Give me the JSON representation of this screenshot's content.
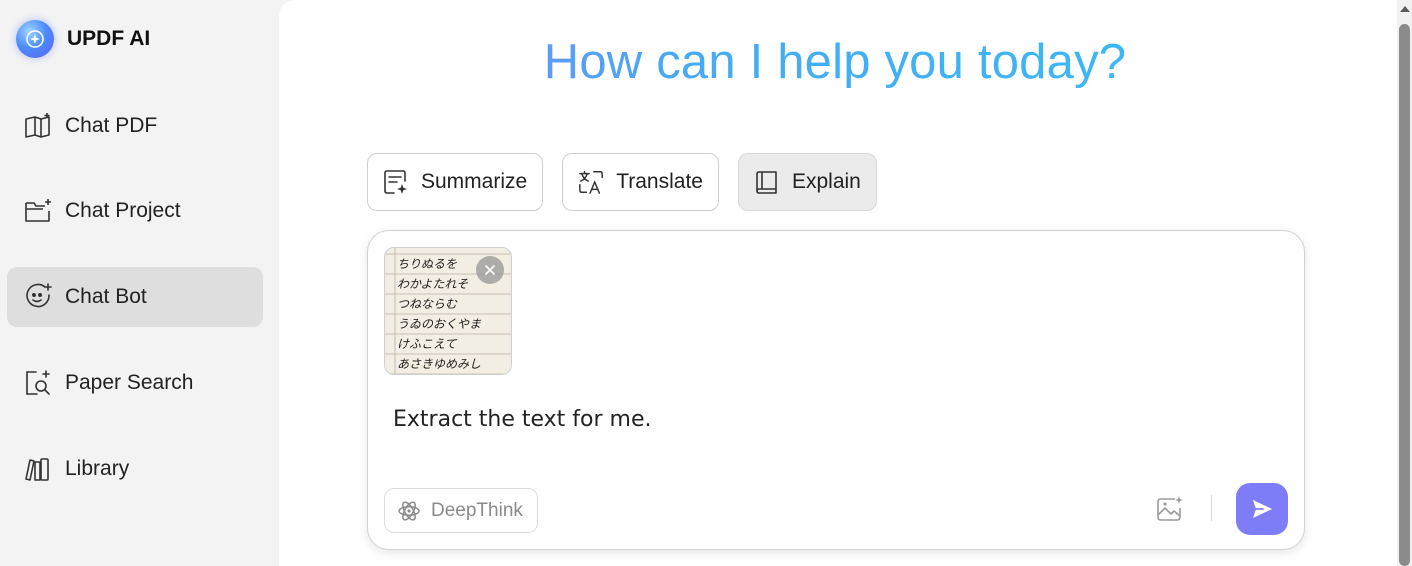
{
  "app": {
    "name": "UPDF AI",
    "logo_icon": "updf-sparkle-logo-icon"
  },
  "sidebar": {
    "items": [
      {
        "label": "Chat PDF",
        "icon": "book-sparkle-icon",
        "active": false
      },
      {
        "label": "Chat Project",
        "icon": "folder-sparkle-icon",
        "active": false
      },
      {
        "label": "Chat Bot",
        "icon": "bot-face-icon",
        "active": true
      },
      {
        "label": "Paper Search",
        "icon": "doc-search-icon",
        "active": false
      },
      {
        "label": "Library",
        "icon": "library-books-icon",
        "active": false
      }
    ]
  },
  "main": {
    "headline": "How can I help you today?",
    "actions": [
      {
        "label": "Summarize",
        "icon": "summarize-icon",
        "selected": false
      },
      {
        "label": "Translate",
        "icon": "translate-icon",
        "selected": false
      },
      {
        "label": "Explain",
        "icon": "book-icon",
        "selected": true
      }
    ],
    "composer": {
      "attachment": {
        "kind": "image",
        "handwritten_lines": [
          "ちりぬるを",
          "わかよたれそ",
          "つねならむ",
          "うゐのおくやま",
          "けふこえて",
          "あさきゆめみし"
        ]
      },
      "prompt_value": "Extract the text for me.",
      "deepthink_label": "DeepThink",
      "upload_icon": "image-upload-icon",
      "send_icon": "send-icon"
    }
  },
  "colors": {
    "accent": "#7f7cf7",
    "headline_gradient_start": "#8e7cf6",
    "headline_gradient_end": "#33c0f4",
    "sidebar_active_bg": "#dedede"
  }
}
